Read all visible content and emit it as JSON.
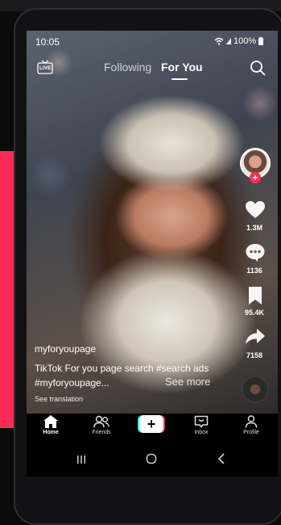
{
  "status_bar": {
    "time": "10:05",
    "battery": "100%"
  },
  "top_bar": {
    "live_label": "LIVE",
    "tabs": [
      {
        "label": "Following",
        "active": false
      },
      {
        "label": "For You",
        "active": true
      }
    ]
  },
  "actions": {
    "likes": "1.3M",
    "comments": "1136",
    "bookmarks": "95.4K",
    "shares": "7158"
  },
  "post": {
    "username": "myforyoupage",
    "caption": "TikTok For you page search #search ads #myforyoupage...",
    "see_more": "See more",
    "see_translation": "See translation"
  },
  "bottom_nav": [
    {
      "label": "Home",
      "icon": "home-icon",
      "active": true
    },
    {
      "label": "Friends",
      "icon": "friends-icon",
      "active": false
    },
    {
      "label": "",
      "icon": "plus-icon",
      "active": false
    },
    {
      "label": "Inbox",
      "icon": "inbox-icon",
      "active": false
    },
    {
      "label": "Profile",
      "icon": "profile-icon",
      "active": false
    }
  ],
  "colors": {
    "accent_pink": "#fe2c55",
    "accent_cyan": "#25f4ee",
    "nav_bg": "#000000"
  }
}
